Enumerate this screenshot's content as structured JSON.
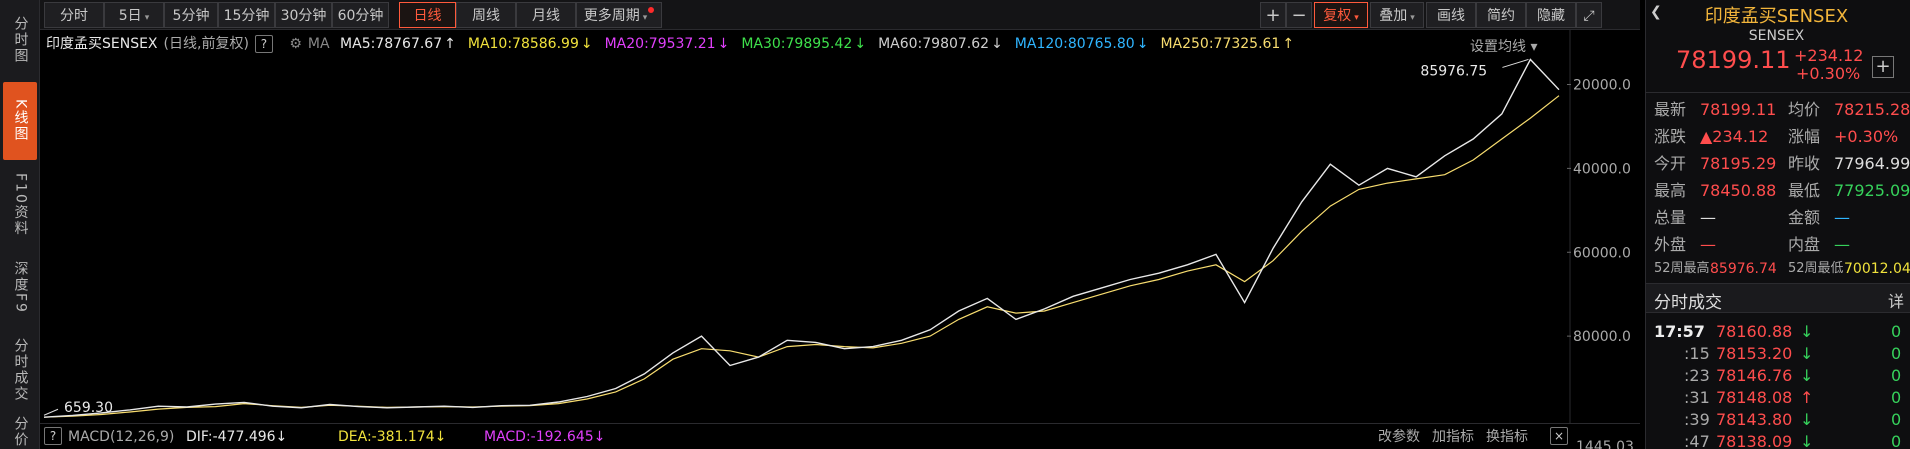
{
  "leftnav": [
    {
      "label": "分时图",
      "active": false
    },
    {
      "label": "K线图",
      "active": true
    },
    {
      "label": "F10资料",
      "active": false
    },
    {
      "label": "深度F9",
      "active": false
    },
    {
      "label": "分时成交",
      "active": false
    },
    {
      "label": "分价",
      "active": false
    }
  ],
  "toolbar": {
    "periods": [
      "分时",
      "5日",
      "5分钟",
      "15分钟",
      "30分钟",
      "60分钟",
      "日线",
      "周线",
      "月线",
      "更多周期"
    ],
    "active_period": "日线",
    "plus": "+",
    "minus": "−",
    "fuquan": "复权",
    "diejia": "叠加",
    "huaxian": "画线",
    "jianyue": "简约",
    "yincang": "隐藏",
    "expand": "⤢"
  },
  "chart": {
    "title": "印度孟买SENSEX",
    "subtitle": "(日线,前复权)",
    "help": "?",
    "ma_label": "MA",
    "ma": [
      {
        "text": "MA5:78767.67",
        "arrow": "↑",
        "color": "#e8e8e8"
      },
      {
        "text": "MA10:78586.99",
        "arrow": "↓",
        "color": "#f0e23c"
      },
      {
        "text": "MA20:79537.21",
        "arrow": "↓",
        "color": "#e040fb"
      },
      {
        "text": "MA30:79895.42",
        "arrow": "↓",
        "color": "#3ee04b"
      },
      {
        "text": "MA60:79807.62",
        "arrow": "↓",
        "color": "#cfcfcf"
      },
      {
        "text": "MA120:80765.80",
        "arrow": "↓",
        "color": "#2fb5ff"
      },
      {
        "text": "MA250:77325.61",
        "arrow": "↑",
        "color": "#f7dc6f"
      }
    ],
    "settings": "设置均线 ▾",
    "max_label": "85976.75",
    "min_label": "659.30",
    "yaxis": [
      "80000.0",
      "60000.0",
      "40000.0",
      "20000.0"
    ],
    "lower_axis": "1445.03"
  },
  "chart_data": {
    "type": "line",
    "title": "印度孟买SENSEX",
    "xlabel": "",
    "ylabel": "",
    "ylim": [
      0,
      93000
    ],
    "y_ticks": [
      20000,
      40000,
      60000,
      80000
    ],
    "grid": false,
    "series": [
      {
        "name": "MA250",
        "color": "#f7dc6f",
        "values": [
          659.3,
          900,
          1300,
          1900,
          2600,
          3000,
          3200,
          3900,
          3400,
          3000,
          3500,
          3300,
          3000,
          3100,
          3200,
          3100,
          3300,
          3400,
          3900,
          5000,
          6700,
          9800,
          14500,
          17000,
          16500,
          15000,
          17500,
          18000,
          17500,
          17200,
          18300,
          20000,
          24000,
          27000,
          25500,
          26000,
          28000,
          30000,
          32000,
          33500,
          35500,
          37000,
          33000,
          38000,
          45000,
          51000,
          55000,
          56500,
          57500,
          58500,
          62000,
          67000,
          72000,
          77325.61
        ]
      },
      {
        "name": "MA5",
        "color": "#e8e8e8",
        "values": [
          659.3,
          1100,
          1700,
          2400,
          3300,
          3100,
          3800,
          4200,
          3300,
          2900,
          3700,
          3200,
          2900,
          3100,
          3300,
          3000,
          3400,
          3500,
          4300,
          5600,
          7500,
          11000,
          16000,
          20000,
          13000,
          15000,
          19000,
          18500,
          17000,
          17500,
          19000,
          21500,
          26000,
          29000,
          24000,
          26500,
          29500,
          31500,
          33500,
          35000,
          37000,
          39500,
          28000,
          41000,
          52000,
          61000,
          56000,
          60000,
          58000,
          63000,
          67000,
          73000,
          85976.75,
          78767.67
        ]
      }
    ],
    "max_price": 85976.75,
    "min_price": 659.3
  },
  "macd": {
    "help": "?",
    "label": "MACD(12,26,9)",
    "dif": "DIF:-477.496",
    "dif_arrow": "↓",
    "dea": "DEA:-381.174",
    "dea_arrow": "↓",
    "macd": "MACD:-192.645",
    "macd_arrow": "↓",
    "btn_params": "改参数",
    "btn_add": "加指标",
    "btn_swap": "换指标",
    "btn_close": "×"
  },
  "quote": {
    "name": "印度孟买SENSEX",
    "code": "SENSEX",
    "price": "78199.11",
    "change": "+234.12",
    "change_pct": "+0.30%",
    "add_btn": "+",
    "rows": [
      {
        "l1": "最新",
        "v1": "78199.11",
        "c1": "red",
        "l2": "均价",
        "v2": "78215.28",
        "c2": "red"
      },
      {
        "l1": "涨跌",
        "v1": "▲234.12",
        "c1": "red",
        "l2": "涨幅",
        "v2": "+0.30%",
        "c2": "red"
      },
      {
        "l1": "今开",
        "v1": "78195.29",
        "c1": "red",
        "l2": "昨收",
        "v2": "77964.99",
        "c2": "white"
      },
      {
        "l1": "最高",
        "v1": "78450.88",
        "c1": "red",
        "l2": "最低",
        "v2": "77925.09",
        "c2": "green"
      },
      {
        "l1": "总量",
        "v1": "—",
        "c1": "white",
        "l2": "金额",
        "v2": "—",
        "c2": "blue"
      },
      {
        "l1": "外盘",
        "v1": "—",
        "c1": "red",
        "l2": "内盘",
        "v2": "—",
        "c2": "green"
      }
    ],
    "w52_high_label": "52周最高",
    "w52_high": "85976.74",
    "w52_low_label": "52周最低",
    "w52_low": "70012.04"
  },
  "ticks": {
    "title": "分时成交",
    "detail": "详",
    "items": [
      {
        "time": "17:57",
        "price": "78160.88",
        "arrow": "↓",
        "dir": "green",
        "vol": "0"
      },
      {
        "time": ":15",
        "price": "78153.20",
        "arrow": "↓",
        "dir": "green",
        "vol": "0"
      },
      {
        "time": ":23",
        "price": "78146.76",
        "arrow": "↓",
        "dir": "green",
        "vol": "0"
      },
      {
        "time": ":31",
        "price": "78148.08",
        "arrow": "↑",
        "dir": "red",
        "vol": "0"
      },
      {
        "time": ":39",
        "price": "78143.80",
        "arrow": "↓",
        "dir": "green",
        "vol": "0"
      },
      {
        "time": ":47",
        "price": "78138.09",
        "arrow": "↓",
        "dir": "green",
        "vol": "0"
      }
    ]
  }
}
